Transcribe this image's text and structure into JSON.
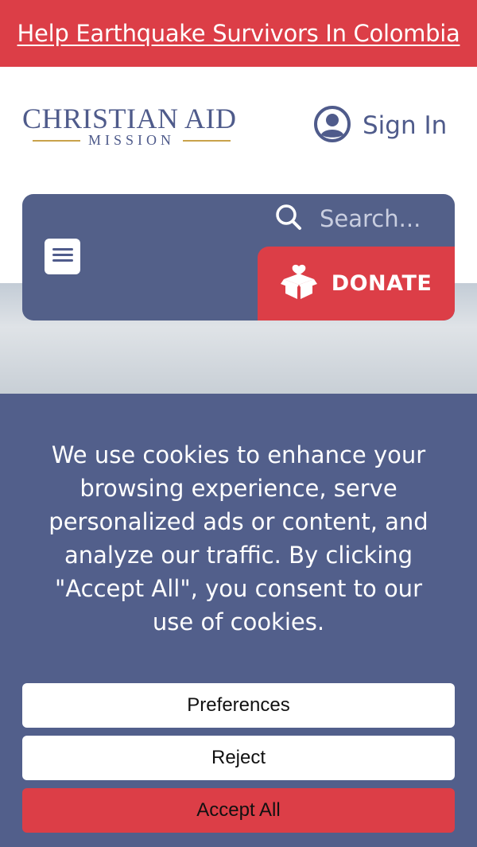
{
  "banner": {
    "link_text": "Help Earthquake Survivors In Colombia"
  },
  "header": {
    "logo_main": "CHRISTIAN AID",
    "logo_sub": "MISSION",
    "sign_in_label": "Sign In"
  },
  "nav": {
    "search_placeholder": "Search...",
    "donate_label": "DONATE"
  },
  "cookie_banner": {
    "message": "We use cookies to enhance your browsing experience, serve personalized ads or content, and analyze our traffic. By clicking \"Accept All\", you consent to our use of cookies.",
    "preferences_label": "Preferences",
    "reject_label": "Reject",
    "accept_label": "Accept All"
  },
  "colors": {
    "brand_red": "#dc3e47",
    "brand_blue": "#536089",
    "logo_gold": "#c9a24b"
  },
  "icons": [
    "user-circle-icon",
    "search-icon",
    "hamburger-menu-icon",
    "gift-box-heart-icon"
  ]
}
